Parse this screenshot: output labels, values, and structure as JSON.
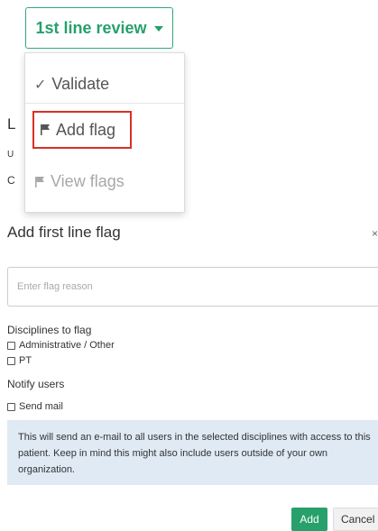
{
  "dropdown": {
    "label": "1st line review",
    "caret_icon": "caret-down-icon",
    "accent_color": "#27a06c",
    "items": [
      {
        "label": "Validate",
        "icon": "check-icon",
        "disabled": false
      },
      {
        "label": "Add flag",
        "icon": "flag-icon",
        "highlighted": true
      },
      {
        "label": "View flags",
        "icon": "flag-icon",
        "disabled": true
      }
    ],
    "highlight_color": "#d93025"
  },
  "background_fragments": [
    "L",
    "U",
    "C"
  ],
  "form": {
    "title": "Add first line flag",
    "reason_placeholder": "Enter flag reason",
    "reason_value": "",
    "disciplines_label": "Disciplines to flag",
    "disciplines": [
      {
        "label": "Administrative / Other",
        "checked": false
      },
      {
        "label": "PT",
        "checked": false
      }
    ],
    "notify_label": "Notify users",
    "send_mail_label": "Send mail",
    "send_mail_checked": false,
    "info_text": "This will send an e-mail to all users in the selected disciplines with access to this patient. Keep in mind this might also include users outside of your own organization.",
    "info_bg_color": "#dfeaf5"
  },
  "actions": {
    "add_label": "Add",
    "cancel_label": "Cancel",
    "add_color": "#27a06c"
  }
}
